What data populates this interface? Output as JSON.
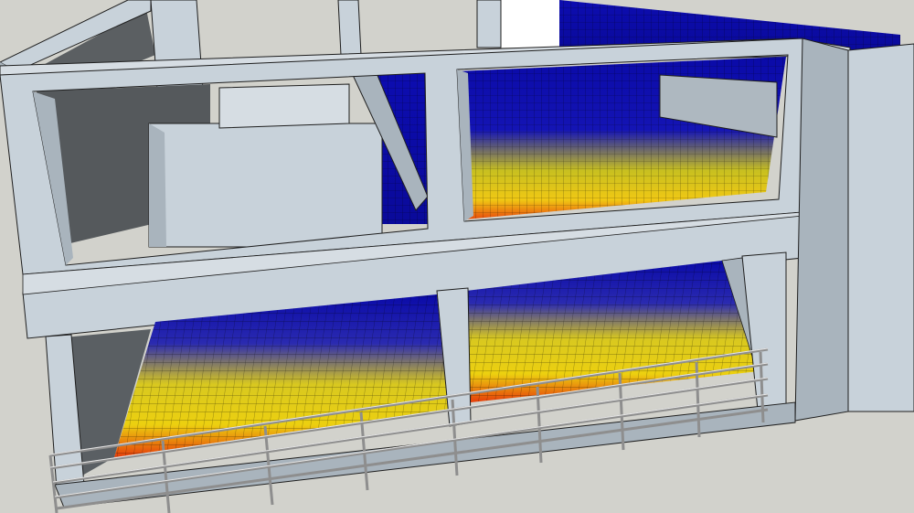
{
  "scene": {
    "colors": {
      "background": "#d2d2cc",
      "concrete_front": "#c8d2da",
      "concrete_light": "#d6dde3",
      "concrete_side": "#a9b4bd",
      "concrete_shadow": "#5a5f63",
      "concrete_dark": "#45494c",
      "edge": "#1e1e1e",
      "sky_opening": "#ffffff",
      "heat_low": "#0a0aa8",
      "heat_mid": "#e0d010",
      "heat_high": "#e8320a",
      "railing": "#b4b4b4"
    },
    "legend_levels": [
      {
        "level": "low",
        "color": "#0a0aa8"
      },
      {
        "level": "medium",
        "color": "#e0d010"
      },
      {
        "level": "high",
        "color": "#e8320a"
      }
    ]
  }
}
